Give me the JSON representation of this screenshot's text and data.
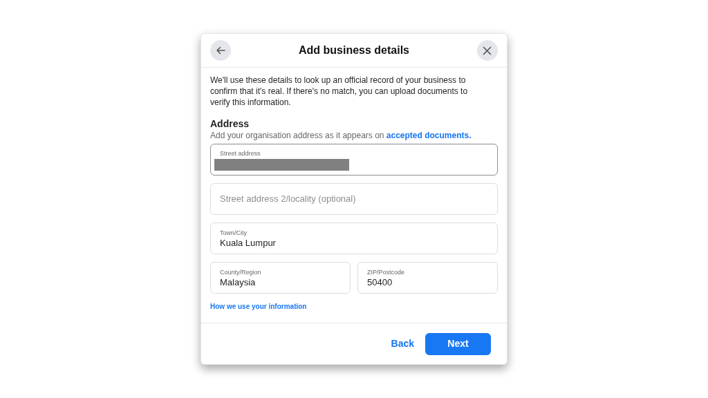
{
  "dialog": {
    "title": "Add business details"
  },
  "intro": "We'll use these details to look up an official record of your business to confirm that it's real. If there's no match, you can upload documents to verify this information.",
  "section": {
    "heading": "Address",
    "subtitle": "Add your organisation address as it appears on",
    "link": "accepted documents."
  },
  "fields": [
    {
      "kind": "redacted",
      "label": "Street address",
      "focused": true
    },
    {
      "kind": "empty",
      "placeholder": "Street address 2/locality (optional)",
      "focused": false
    },
    {
      "kind": "filled",
      "label": "Town/City",
      "value": "Kuala Lumpur",
      "focused": false
    }
  ],
  "field_pair": [
    {
      "kind": "filled",
      "label": "County/Region",
      "value": "Malaysia",
      "focused": false
    },
    {
      "kind": "filled",
      "label": "ZIP/Postcode",
      "value": "50400",
      "focused": false
    }
  ],
  "info_link": "How we use your information",
  "buttons": {
    "back": "Back",
    "next": "Next"
  }
}
